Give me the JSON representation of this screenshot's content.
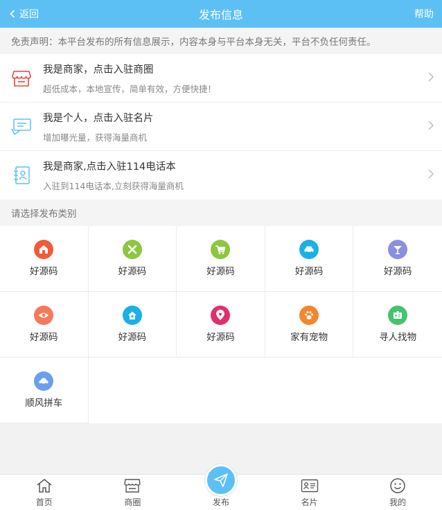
{
  "header": {
    "back_label": "返回",
    "title": "发布信息",
    "help_label": "帮助"
  },
  "disclaimer": "免责声明：本平台发布的所有信息展示，内容本身与平台本身无关，平台不负任何责任。",
  "entries": [
    {
      "icon": "shop-icon",
      "title": "我是商家，点击入驻商圈",
      "subtitle": "超低成本，本地宣传，简单有效，方便快捷！"
    },
    {
      "icon": "card-icon",
      "title": "我是个人，点击入驻名片",
      "subtitle": "增加曝光量，获得海量商机"
    },
    {
      "icon": "contact-book-icon",
      "title": "我是商家,点击入驻114电话本",
      "subtitle": "入驻到114电话本,立刻获得海量商机"
    }
  ],
  "category_label": "请选择发布类别",
  "categories": [
    {
      "label": "好源码",
      "icon": "house-icon",
      "color": "#f25a38"
    },
    {
      "label": "好源码",
      "icon": "tools-icon",
      "color": "#8dc63f"
    },
    {
      "label": "好源码",
      "icon": "cart-icon",
      "color": "#8dc63f"
    },
    {
      "label": "好源码",
      "icon": "car-icon",
      "color": "#1ab0e8"
    },
    {
      "label": "好源码",
      "icon": "cocktail-icon",
      "color": "#8b8fe0"
    },
    {
      "label": "好源码",
      "icon": "eye-icon",
      "color": "#f47b5a"
    },
    {
      "label": "好源码",
      "icon": "home-icon",
      "color": "#1ab0e8"
    },
    {
      "label": "好源码",
      "icon": "location-heart-icon",
      "color": "#e0306a"
    },
    {
      "label": "家有宠物",
      "icon": "paw-icon",
      "color": "#f5862e"
    },
    {
      "label": "寻人找物",
      "icon": "id-card-icon",
      "color": "#48c170"
    },
    {
      "label": "顺风拼车",
      "icon": "car-icon",
      "color": "#6a9ff0"
    }
  ],
  "tabs": [
    {
      "label": "首页",
      "icon": "home-icon"
    },
    {
      "label": "商圈",
      "icon": "shop-icon"
    },
    {
      "label": "发布",
      "icon": "paper-plane-icon"
    },
    {
      "label": "名片",
      "icon": "card-icon"
    },
    {
      "label": "我的",
      "icon": "smile-icon"
    }
  ],
  "colors": {
    "accent": "#5cc0f5",
    "shop_red": "#e8453c",
    "card_blue": "#5cc0f5"
  }
}
